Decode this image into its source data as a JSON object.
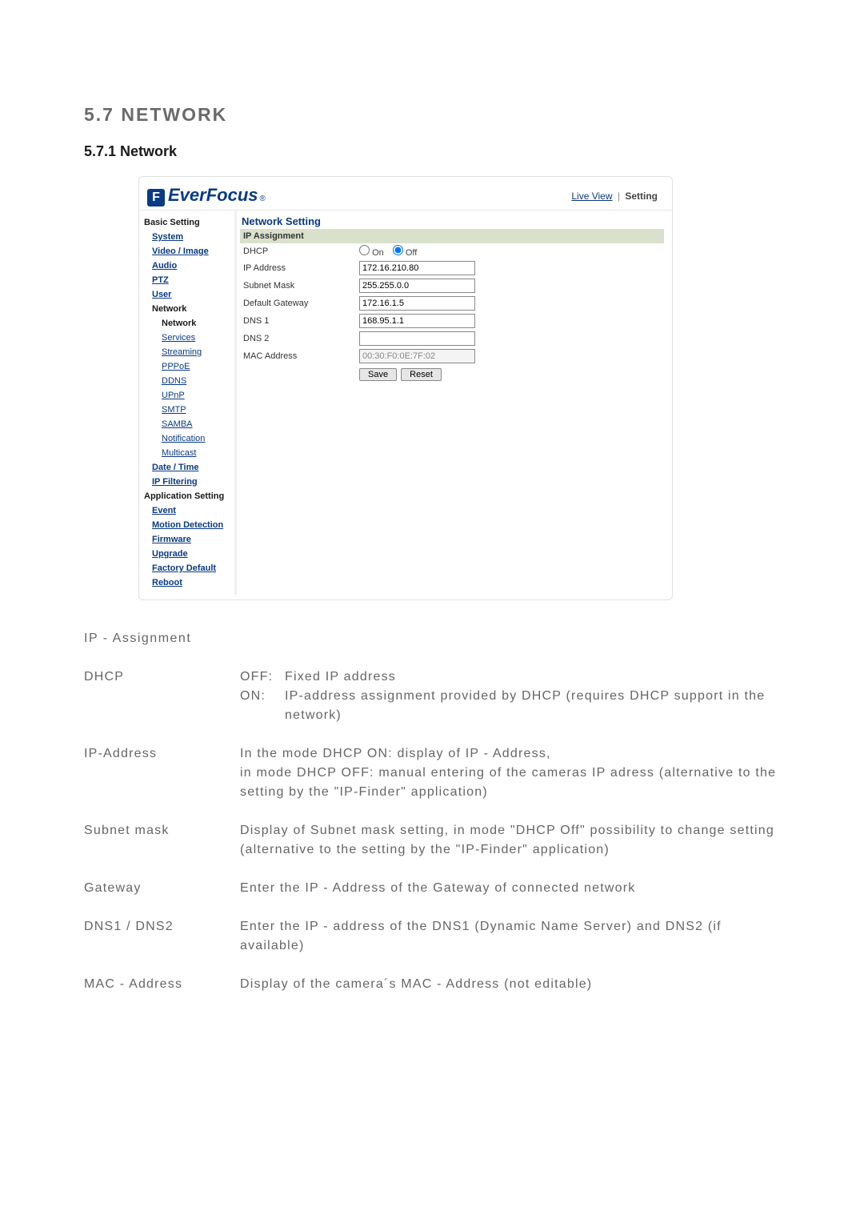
{
  "headings": {
    "main": "5.7 NETWORK",
    "sub": "5.7.1 Network"
  },
  "app": {
    "logo_text": "EverFocus",
    "logo_mark": "F",
    "logo_reg": "®",
    "header_links": {
      "live": "Live View",
      "setting": "Setting"
    },
    "sidebar": {
      "basic_title": "Basic Setting",
      "system": "System",
      "video_image": "Video / Image",
      "audio": "Audio",
      "ptz": "PTZ",
      "user": "User",
      "network": "Network",
      "sub_network": "Network",
      "services": "Services",
      "streaming": "Streaming",
      "pppoe": "PPPoE",
      "ddns": "DDNS",
      "upnp": "UPnP",
      "smtp": "SMTP",
      "samba": "SAMBA",
      "notification": "Notification",
      "multicast": "Multicast",
      "date_time": "Date / Time",
      "ip_filtering": "IP Filtering",
      "app_title": "Application Setting",
      "event": "Event",
      "motion": "Motion Detection",
      "firmware": "Firmware",
      "upgrade": "Upgrade",
      "factory": "Factory Default",
      "reboot": "Reboot"
    },
    "content": {
      "title": "Network Setting",
      "bar": "IP Assignment",
      "dhcp_label": "DHCP",
      "dhcp_on": "On",
      "dhcp_off": "Off",
      "ip_label": "IP Address",
      "ip_value": "172.16.210.80",
      "subnet_label": "Subnet Mask",
      "subnet_value": "255.255.0.0",
      "gateway_label": "Default Gateway",
      "gateway_value": "172.16.1.5",
      "dns1_label": "DNS 1",
      "dns1_value": "168.95.1.1",
      "dns2_label": "DNS 2",
      "dns2_value": "",
      "mac_label": "MAC Address",
      "mac_value": "00:30:F0:0E:7F:02",
      "save": "Save",
      "reset": "Reset"
    }
  },
  "doc": {
    "subtitle": "IP - Assignment",
    "rows": {
      "dhcp_term": "DHCP",
      "dhcp_off_k": "OFF:",
      "dhcp_off_v": "Fixed IP address",
      "dhcp_on_k": "ON:",
      "dhcp_on_v": "IP-address assignment provided by DHCP (requires DHCP support in the network)",
      "ip_term": "IP-Address",
      "ip_desc": "In the mode DHCP ON: display of IP - Address,\nin mode DHCP OFF: manual entering of the cameras IP adress (alternative to the setting by the \"IP-Finder\" application)",
      "subnet_term": "Subnet mask",
      "subnet_desc": "Display of Subnet mask setting, in mode \"DHCP Off\" possibility to change setting\n(alternative to the setting by the \"IP-Finder\" application)",
      "gateway_term": "Gateway",
      "gateway_desc": "Enter the IP - Address of the Gateway of connected network",
      "dns_term": "DNS1 / DNS2",
      "dns_desc": "Enter the IP - address of the DNS1 (Dynamic Name Server) and DNS2 (if available)",
      "mac_term": "MAC - Address",
      "mac_desc": "Display of the camera´s MAC - Address (not editable)"
    }
  }
}
